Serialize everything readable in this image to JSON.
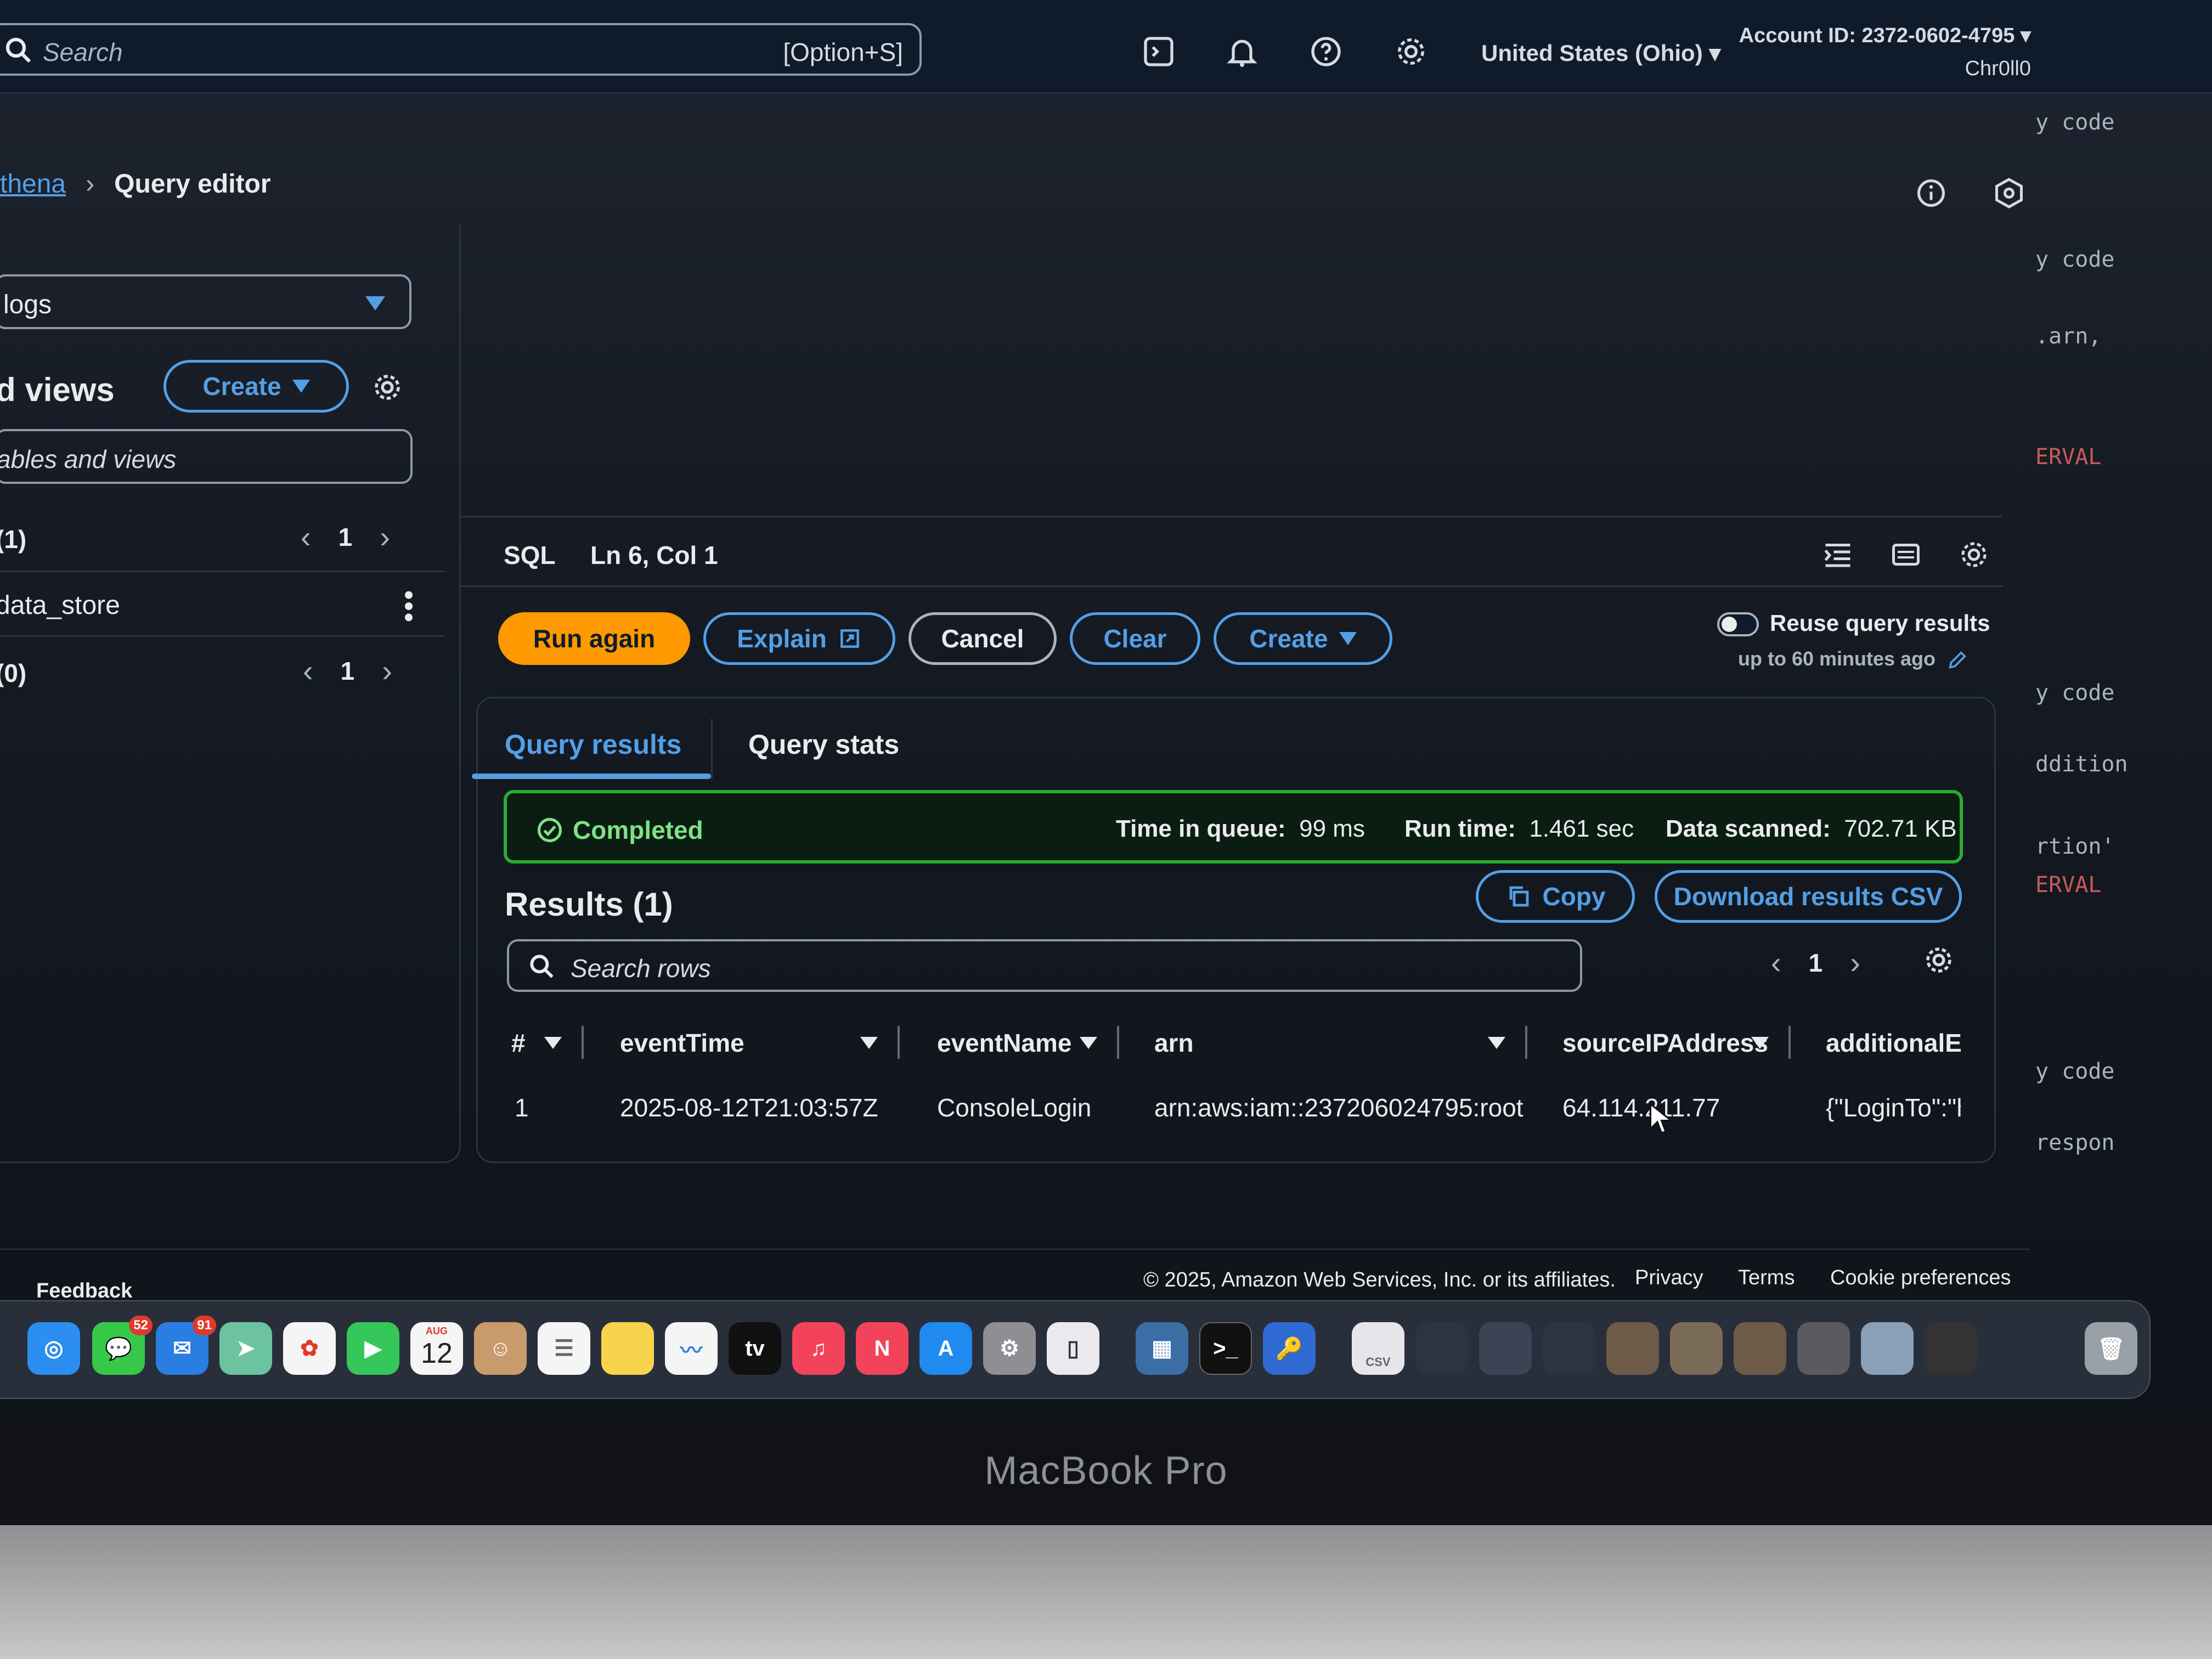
{
  "topnav": {
    "search_placeholder": "Search",
    "search_shortcut": "[Option+S]",
    "region": "United States (Ohio)",
    "account": "Account ID: 2372-0602-4795",
    "user": "Chr0ll0",
    "icons": [
      "cloudshell-icon",
      "bell-icon",
      "help-icon",
      "gear-icon"
    ]
  },
  "breadcrumb": {
    "parent": "thena",
    "current": "Query editor"
  },
  "left_panel": {
    "database_value": "logs",
    "tables_heading": "d views",
    "create_label": "Create",
    "filter_placeholder": "ables and views",
    "tables_count": "(1)",
    "tables_page": "1",
    "table_item": "data_store",
    "views_count": "(0)",
    "views_page": "1"
  },
  "editor": {
    "language": "SQL",
    "cursor_position": "Ln 6, Col 1",
    "buttons": {
      "run_again": "Run again",
      "explain": "Explain",
      "cancel": "Cancel",
      "clear": "Clear",
      "create": "Create"
    },
    "reuse_label": "Reuse query results",
    "reuse_sub": "up to 60 minutes ago",
    "reuse_enabled": false
  },
  "results": {
    "tabs": [
      "Query results",
      "Query stats"
    ],
    "active_tab": "Query results",
    "status": "Completed",
    "time_in_queue_label": "Time in queue:",
    "time_in_queue_value": "99 ms",
    "run_time_label": "Run time:",
    "run_time_value": "1.461 sec",
    "data_scanned_label": "Data scanned:",
    "data_scanned_value": "702.71 KB",
    "title": "Results (1)",
    "copy_label": "Copy",
    "download_label": "Download results CSV",
    "search_placeholder": "Search rows",
    "page": "1",
    "columns": [
      "#",
      "eventTime",
      "eventName",
      "arn",
      "sourceIPAddress",
      "additionalEv"
    ],
    "rows": [
      [
        "1",
        "2025-08-12T21:03:57Z",
        "ConsoleLogin",
        "arn:aws:iam::237206024795:root",
        "64.114.211.77",
        "{\"LoginTo\":\"h"
      ]
    ]
  },
  "footer": {
    "feedback": "Feedback",
    "copyright": "© 2025, Amazon Web Services, Inc. or its affiliates.",
    "privacy": "Privacy",
    "terms": "Terms",
    "cookies": "Cookie preferences"
  },
  "code_strip": {
    "lines": [
      "y code",
      "y code",
      ".arn,",
      "ERVAL",
      "y code",
      "ddition",
      "rtion'",
      "ERVAL",
      "y code",
      "respon"
    ]
  },
  "dock": {
    "messages_badge": "52",
    "mail_badge": "91",
    "calendar_month": "AUG",
    "calendar_day": "12",
    "tv_label": "tv",
    "csv_label": "CSV"
  },
  "device": {
    "label": "MacBook Pro"
  },
  "colors": {
    "accent": "#539fe5",
    "primary_button": "#ff9900",
    "success": "#29ad32",
    "background": "#0f1b2a"
  }
}
